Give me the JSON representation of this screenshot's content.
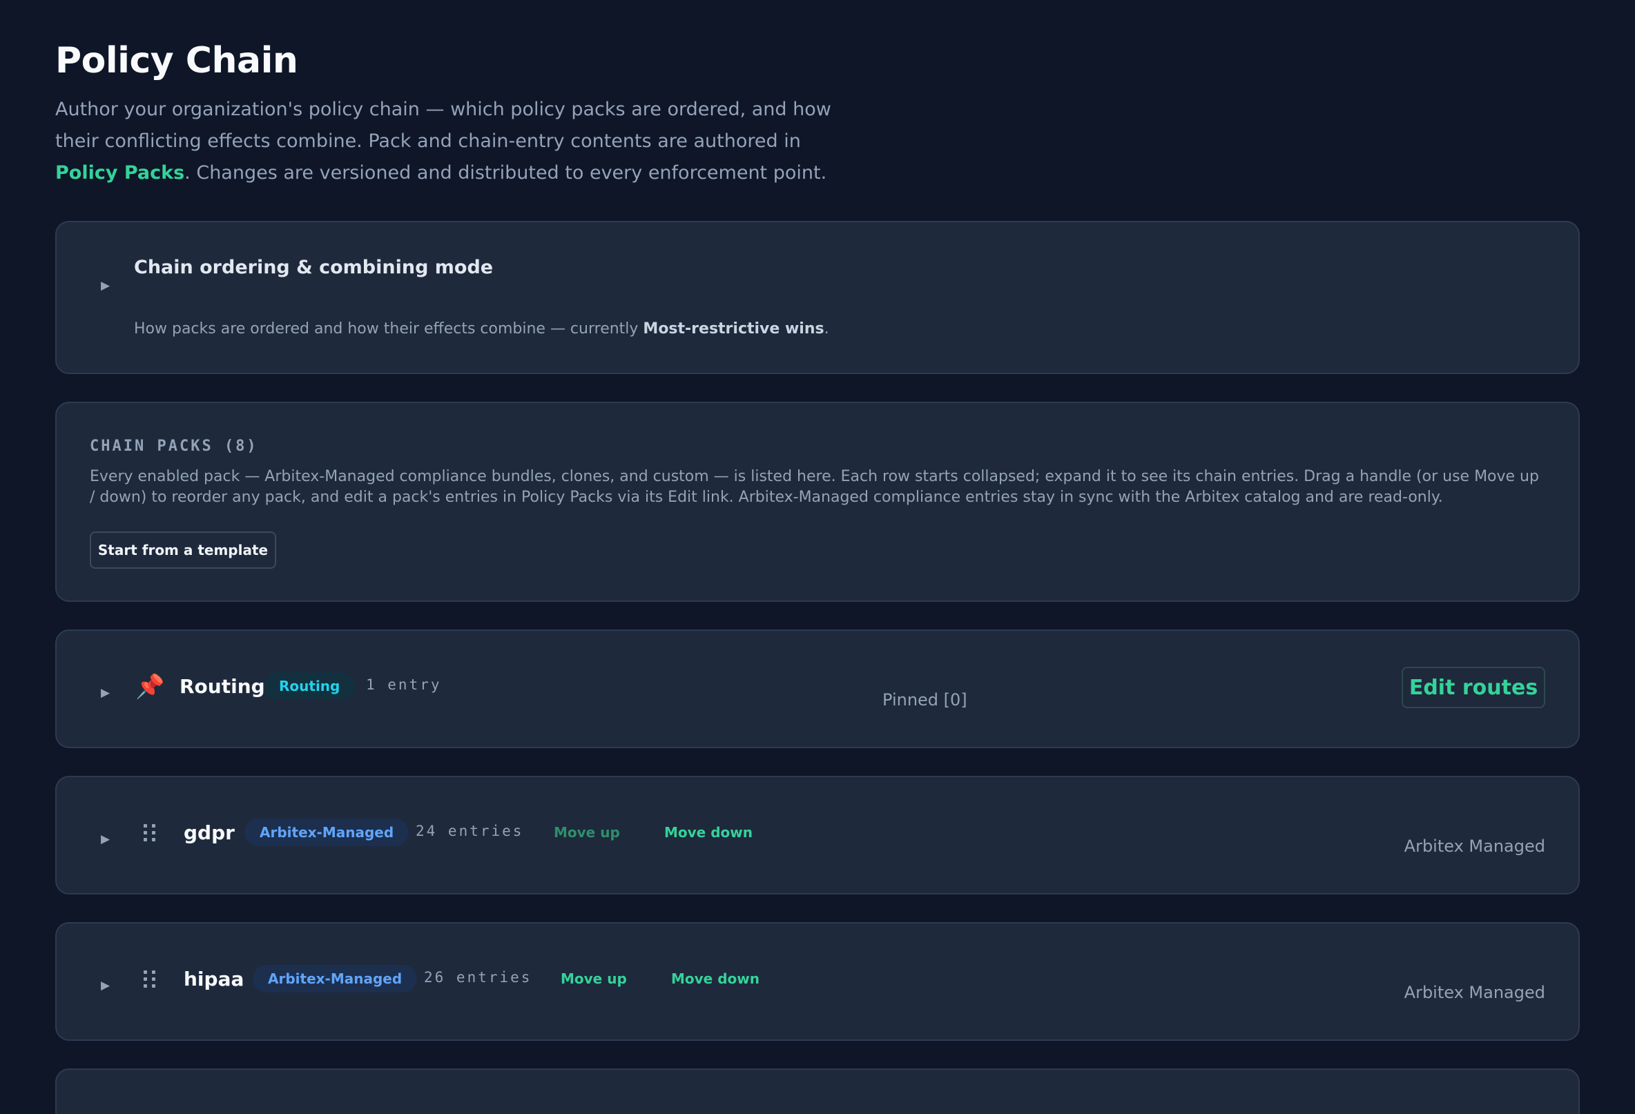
{
  "header": {
    "title": "Policy Chain",
    "desc_part1": "Author your organization's policy chain — which policy packs are ordered, and how their conflicting effects combine. Pack and chain-entry contents are authored in ",
    "desc_link": "Policy Packs",
    "desc_part2": ". Changes are versioned and distributed to every enforcement point."
  },
  "ordering_card": {
    "title": "Chain ordering & combining mode",
    "summary_prefix": "How packs are ordered and how their effects combine — currently ",
    "summary_mode": "Most-restrictive wins",
    "summary_suffix": "."
  },
  "packs_card": {
    "heading": "CHAIN PACKS (8)",
    "description": "Every enabled pack — Arbitex-Managed compliance bundles, clones, and custom — is listed here. Each row starts collapsed; expand it to see its chain entries. Drag a handle (or use Move up / down) to reorder any pack, and edit a pack's entries in Policy Packs via its Edit link. Arbitex-Managed compliance entries stay in sync with the Arbitex catalog and are read-only.",
    "template_button": "Start from a template"
  },
  "packs": [
    {
      "name": "Routing",
      "badge": "Routing",
      "count": "1 entry",
      "note": "Pinned [0]",
      "action": "Edit routes"
    },
    {
      "name": "gdpr",
      "badge": "Arbitex-Managed",
      "count": "24 entries",
      "move_up": "Move up",
      "move_down": "Move down",
      "note": "Arbitex Managed"
    },
    {
      "name": "hipaa",
      "badge": "Arbitex-Managed",
      "count": "26 entries",
      "move_up": "Move up",
      "move_down": "Move down",
      "note": "Arbitex Managed"
    }
  ],
  "icons": {
    "expand": "caret-right-icon",
    "drag": "drag-handle-icon",
    "pinned": "pushpin-icon"
  },
  "colors": {
    "background": "#0e1628",
    "card": "#1e293b",
    "accent_green": "#34d399",
    "badge_routing": "#22d3ee",
    "badge_managed": "#60a5fa"
  }
}
